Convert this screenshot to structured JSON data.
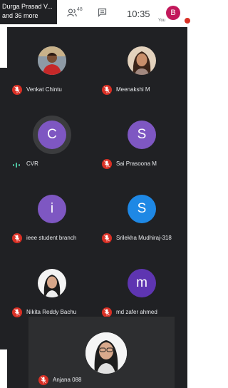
{
  "topbar": {
    "presenter_line1": "Durga Prasad V...",
    "presenter_line2": "and 36 more",
    "participant_count": "48",
    "time": "10:35",
    "self_initial": "B",
    "self_label": "You"
  },
  "colors": {
    "background": "#202124",
    "muted_mic": "#d93025",
    "avatar_purple": "#7e57c2",
    "avatar_blue": "#1e88e5",
    "avatar_indigo": "#5e35b1",
    "self_avatar": "#c2185b",
    "speaking_bars": "#4fc3a1"
  },
  "participants": [
    {
      "name": "Venkat Chintu",
      "avatar": "photo",
      "muted": true
    },
    {
      "name": "Meenakshi M",
      "avatar": "photo",
      "muted": true
    },
    {
      "name": "CVR",
      "initial": "C",
      "avatar": "letter",
      "muted": false,
      "speaking": true
    },
    {
      "name": "Sai Prasoona M",
      "initial": "S",
      "avatar": "letter",
      "muted": true
    },
    {
      "name": "ieee student branch",
      "initial": "i",
      "avatar": "letter",
      "muted": true
    },
    {
      "name": "Srilekha Mudhiraj-318",
      "initial": "S",
      "avatar": "letter",
      "muted": true
    },
    {
      "name": "Nikita Reddy Bachu",
      "avatar": "photo",
      "muted": true
    },
    {
      "name": "md zafer ahmed",
      "initial": "m",
      "avatar": "letter",
      "muted": true
    },
    {
      "name": "Anjana 088",
      "avatar": "photo",
      "muted": true
    }
  ]
}
